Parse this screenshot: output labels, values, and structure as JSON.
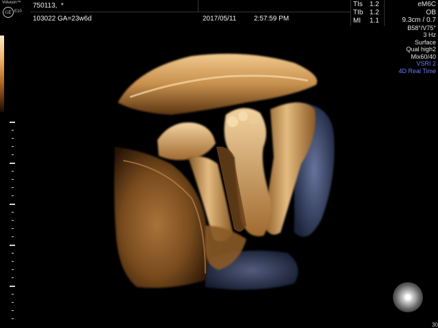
{
  "brand": {
    "name": "Voluson™",
    "logo_text": "GE",
    "model": "E10"
  },
  "header": {
    "patient_id": "750113,  *",
    "exam": "103022  GA=23w6d",
    "date": "2017/05/11",
    "time": "2:57:59 PM"
  },
  "indices": [
    {
      "key": "TIs",
      "value": "1.2"
    },
    {
      "key": "TIb",
      "value": "1.2"
    },
    {
      "key": "MI",
      "value": "1.1"
    }
  ],
  "params": {
    "probe": "eM6C",
    "preset": "OB",
    "depth": "9.3cm / 0.7",
    "angles": "B58°/V75°",
    "rate": "3 Hz",
    "render_mode": "Surface",
    "quality": "Qual high2",
    "mix": "Mix60/40",
    "vsri": "VSRI 2",
    "mode": "4D Real Time"
  },
  "colors": {
    "blue_text": "#6f7cff",
    "tissue_light": "#e6b77a",
    "tissue_mid": "#b07a3a",
    "tissue_dark": "#4a2a0e",
    "shadow_blue": "#5a6a9a"
  },
  "icons": {
    "orientation": "orientation-sphere-icon",
    "logo": "ge-logo-icon"
  },
  "footer": {
    "frame_counter": "30"
  }
}
